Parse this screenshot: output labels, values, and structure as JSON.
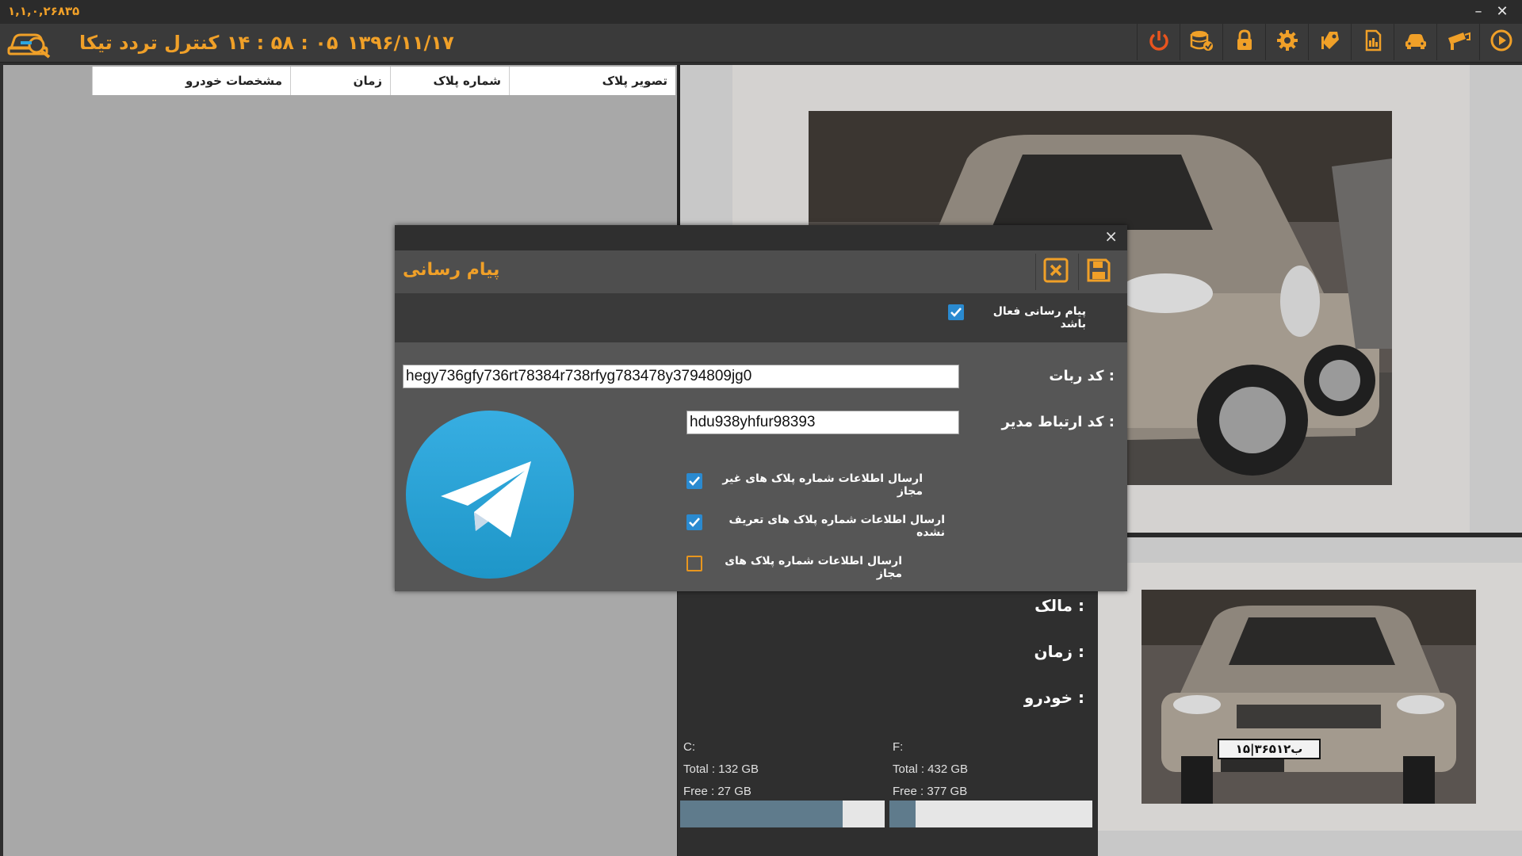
{
  "titlebar": {
    "version": "۱,۱,۰,۲۶۸۳۵",
    "minimize": "–",
    "close": "✕"
  },
  "header": {
    "app_name": "کنترل تردد تیکا",
    "time": "۱۴ : ۵۸ : ۰۵",
    "date": "۱۳۹۶/۱۱/۱۷",
    "toolbar_icons": [
      "play-icon",
      "camera-icon",
      "car-icon",
      "report-icon",
      "tag-icon",
      "gear-icon",
      "lock-icon",
      "database-icon",
      "power-icon"
    ]
  },
  "table": {
    "columns": [
      "تصویر پلاک",
      "شماره پلاک",
      "زمان",
      "مشخصات خودرو"
    ]
  },
  "info": {
    "owner_label": "مالک :",
    "time_label": "زمان :",
    "car_label": "خودرو :"
  },
  "drives": [
    {
      "name": "C:",
      "total": "Total : 132 GB",
      "free": "Free : 27 GB",
      "used_fraction": 0.795
    },
    {
      "name": "F:",
      "total": "Total : 432 GB",
      "free": "Free : 377 GB",
      "used_fraction": 0.127
    }
  ],
  "plate_text": "۱۵|۳۶۵ب۱۲",
  "dialog": {
    "close": "×",
    "title": "پیام رسانی",
    "enabled_label": "پیام رسانی فعال باشد",
    "enabled": true,
    "bot_code_label": "کد ربات :",
    "bot_code_value": "hegy736gfy736rt78384r738rfyg783478y3794809jg0",
    "admin_code_label": "کد ارتباط مدیر :",
    "admin_code_value": "hdu938yhfur98393",
    "options": [
      {
        "label": "ارسال اطلاعات شماره پلاک های غیر مجاز",
        "checked": true
      },
      {
        "label": "ارسال اطلاعات شماره پلاک های تعریف نشده",
        "checked": true
      },
      {
        "label": "ارسال اطلاعات شماره پلاک های مجاز",
        "checked": false
      }
    ]
  },
  "colors": {
    "accent": "#f0a028",
    "check_blue": "#2a8ad0",
    "telegram_blue": "#2ca5e0"
  }
}
